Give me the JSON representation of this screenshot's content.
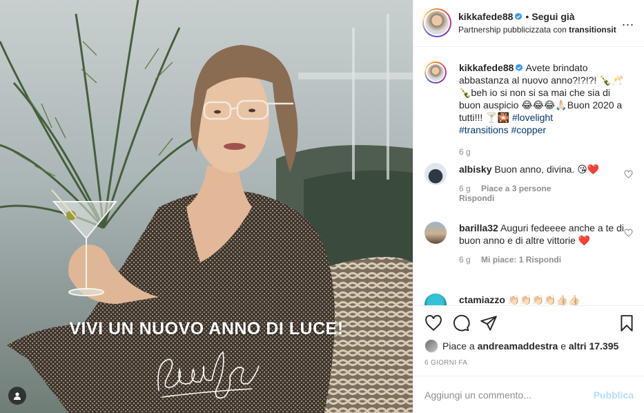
{
  "photo": {
    "overlay_text": "VIVI UN NUOVO ANNO DI LUCE!",
    "signature_text": "Federica Pellegrini",
    "tag_icon": "user-tag-icon"
  },
  "header": {
    "username": "kikkafede88",
    "follow_label": "Segui già",
    "separator": "•",
    "partnership_label": "Partnership pubblicizzata con ",
    "partner": "transitionsit",
    "more_icon": "more-options-icon",
    "more_glyph": "..."
  },
  "caption": {
    "username": "kikkafede88",
    "text": "Avete brindato abbastanza al nuovo anno?!?!?! 🍾🥂🍾beh io si non si sa mai che sia di buon auspicio 😂😂😂🙏🏻Buon 2020 a tutti!!! 🍸🎇 ",
    "hashtag1": "#lovelight",
    "hashtag2": "#transitions",
    "hashtag3": "#copper",
    "age": "6 g"
  },
  "comments": [
    {
      "username": "albisky",
      "text": "Buon anno, divina. 😘❤️",
      "age": "6 g",
      "likes": "Piace a 3 persone",
      "reply": "Rispondi"
    },
    {
      "username": "barilla32",
      "text": "Auguri fedeeee anche a te di buon anno e di altre vittorie ❤️",
      "age": "6 g",
      "likes": "Mi piace: 1",
      "reply": "Rispondi"
    },
    {
      "username": "ctamiazzo",
      "text": "👏🏻👏🏻👏🏻👏🏻👍🏻👍🏻"
    }
  ],
  "actions": {
    "like_prefix": "Piace a ",
    "like_user": "andreamaddestra",
    "like_mid": " e ",
    "like_others": "altri 17.395",
    "time": "6 GIORNI FA"
  },
  "add_comment": {
    "placeholder": "Aggiungi un commento...",
    "publish_label": "Pubblica"
  },
  "colors": {
    "link": "#00376b",
    "muted": "#8e8e8e",
    "publish_disabled": "#b2dffc",
    "verified": "#3897f0"
  }
}
